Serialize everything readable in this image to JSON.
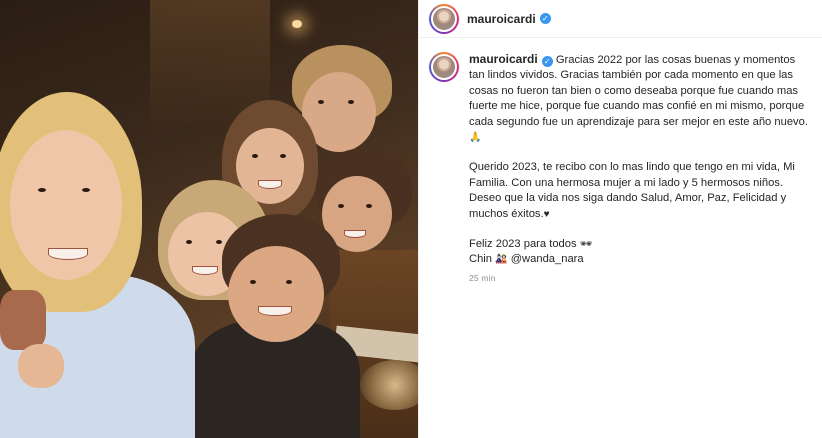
{
  "header": {
    "username": "mauroicardi",
    "verified_icon": "verified-badge-icon"
  },
  "caption": {
    "username": "mauroicardi",
    "paragraph1": "Gracias 2022 por las cosas buenas y momentos tan lindos vividos. Gracias también por cada momento en que las cosas no fueron tan bien o como deseaba porque fue cuando mas fuerte me hice, porque fue cuando mas confié en mi mismo, porque cada segundo fue un aprendizaje para ser mejor en este año nuevo.",
    "paragraph1_emoji": "🙏",
    "paragraph2": "Querido 2023, te recibo con lo mas lindo que tengo en mi vida, Mi Familia. Con una hermosa mujer a mi lado y 5 hermosos niños. Deseo que la vida nos siga dando Salud, Amor, Paz, Felicidad y muchos éxitos.",
    "paragraph2_emoji": "♥",
    "line3": "Feliz 2023 para todos",
    "line3_emoji": "🕶",
    "line4_prefix": "Chin",
    "line4_emoji": "🎎",
    "mention": "@wanda_nara",
    "timestamp": "25 min"
  },
  "colors": {
    "verified": "#3897f0",
    "text": "#262626",
    "muted": "#8e8e8e"
  }
}
